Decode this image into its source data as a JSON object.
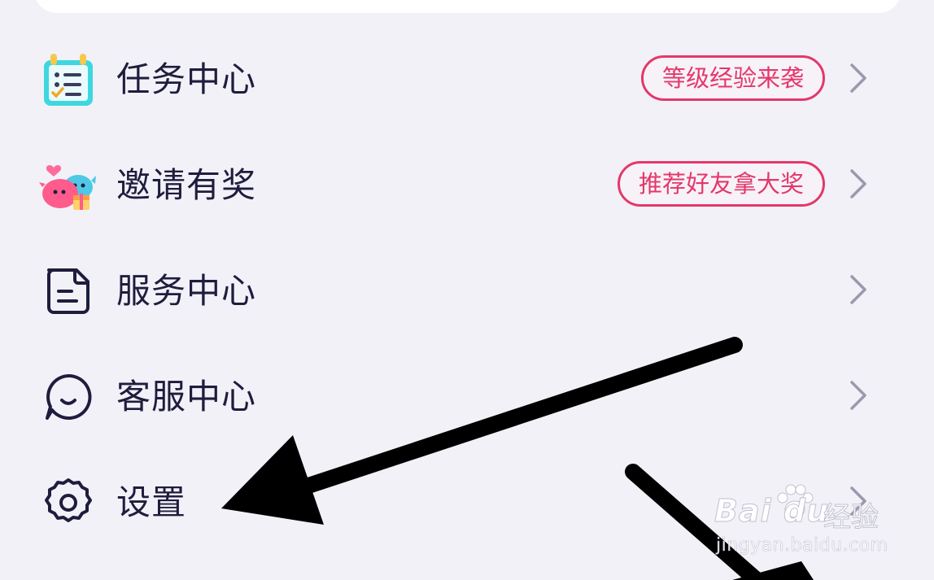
{
  "menu": {
    "items": [
      {
        "label": "任务中心",
        "badge": "等级经验来袭",
        "icon": "task-calendar-icon"
      },
      {
        "label": "邀请有奖",
        "badge": "推荐好友拿大奖",
        "icon": "invite-whales-gift-icon"
      },
      {
        "label": "服务中心",
        "icon": "service-document-icon"
      },
      {
        "label": "客服中心",
        "icon": "customer-service-smile-icon"
      },
      {
        "label": "设置",
        "icon": "settings-gear-icon"
      }
    ]
  },
  "colors": {
    "background": "#f2f1f8",
    "text": "#1f1d3d",
    "badge": "#e3386a",
    "chevron": "#9a99ad",
    "arrow": "#000000"
  },
  "watermark": {
    "logo": "Bai du",
    "brand": "经验",
    "url": "jingyan.baidu.com"
  }
}
